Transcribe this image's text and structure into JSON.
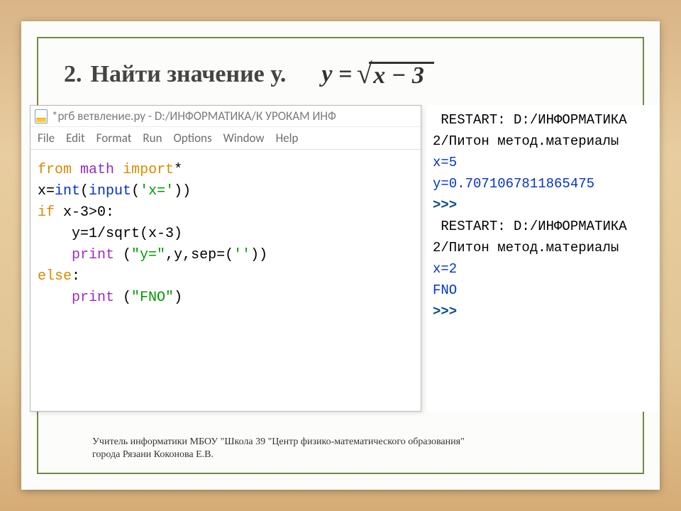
{
  "slide": {
    "number": "2.",
    "title": "Найти значение у.",
    "formula_lhs": "y = ",
    "formula_radicand": "x − 3"
  },
  "editor": {
    "window_title": "*ргб ветвление.ру - D:/ИНФОРМАТИКА/К УРОКАМ ИНФ",
    "menu": [
      "File",
      "Edit",
      "Format",
      "Run",
      "Options",
      "Window",
      "Help"
    ],
    "code": {
      "kw_from": "from",
      "mod": "math",
      "kw_import": "import",
      "star": "*",
      "l2a": "x=",
      "builtin_int": "int",
      "l2b": "(",
      "builtin_input": "input",
      "l2c": "(",
      "str_xeq": "'x='",
      "l2d": "))",
      "kw_if": "if",
      "l3": " x-3>0:",
      "l4": "    y=1/sqrt(x-3)",
      "l5a": "    ",
      "fn_print1": "print",
      "l5b": " (",
      "str_yeq": "\"y=\"",
      "l5c": ",y,sep=(",
      "str_empty": "''",
      "l5d": "))",
      "kw_else": "else",
      "l6": ":",
      "l7a": "    ",
      "fn_print2": "print",
      "l7b": " (",
      "str_fno": "\"FNO\"",
      "l7c": ")"
    }
  },
  "shell": {
    "restart1": " RESTART: D:/ИНФОРМАТИКА",
    "path1": "2/Питон метод.материалы",
    "x5": "x=5",
    "y_val": "y=0.7071067811865475",
    "prompt1": ">>> ",
    "restart2": " RESTART: D:/ИНФОРМАТИКА",
    "path2": "2/Питон метод.материалы",
    "x2": "x=2",
    "fno": "FNO",
    "prompt2": ">>> "
  },
  "footer": {
    "line1": "Учитель информатики МБОУ \"Школа 39 \"Центр физико-математического образования\"",
    "line2": "города Рязани Коконова Е.В."
  }
}
